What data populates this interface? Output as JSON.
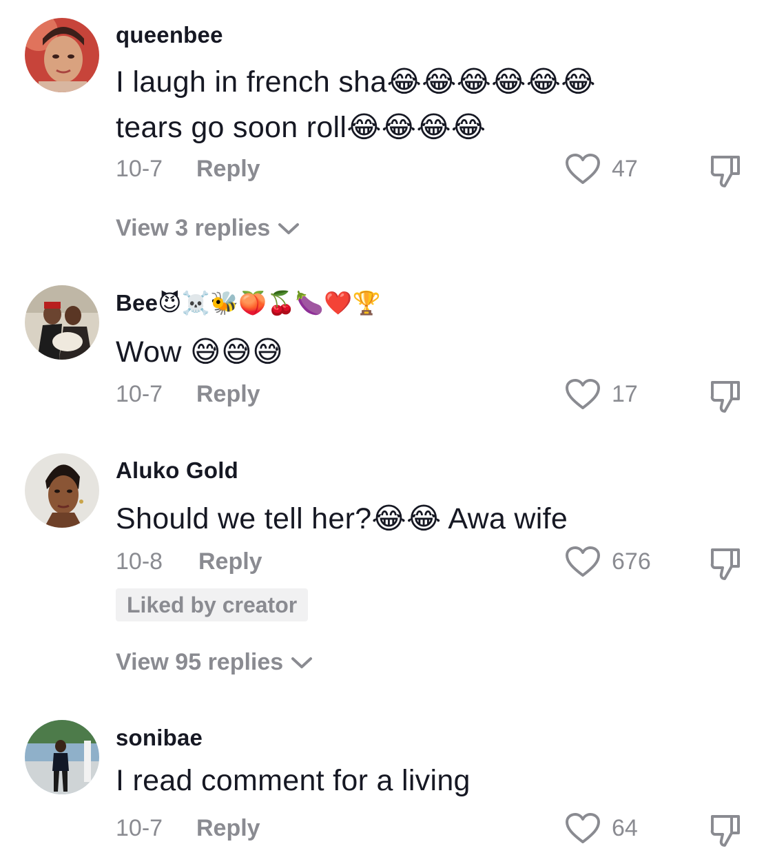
{
  "colors": {
    "text_primary": "#161823",
    "text_secondary": "#8a8b91",
    "badge_bg": "#f1f1f2"
  },
  "comments": [
    {
      "username": "queenbee",
      "text_line1": "I laugh in french sha😂😂😂😂😂😂",
      "text_line2": "tears go soon roll😂😂😂😂",
      "date": "10-7",
      "reply_label": "Reply",
      "likes": "47",
      "view_replies": "View 3 replies"
    },
    {
      "username": "Bee😈☠️🐝🍑🍒🍆❤️🏆",
      "text_line1": "Wow 😅😅😅",
      "date": "10-7",
      "reply_label": "Reply",
      "likes": "17"
    },
    {
      "username": "Aluko Gold",
      "text_line1": "Should we tell her?😂😂 Awa wife",
      "date": "10-8",
      "reply_label": "Reply",
      "likes": "676",
      "badge": "Liked by creator",
      "view_replies": "View 95 replies"
    },
    {
      "username": "sonibae",
      "text_line1": "I read comment for a living",
      "date": "10-7",
      "reply_label": "Reply",
      "likes": "64"
    }
  ],
  "icons": {
    "like": "heart-outline-icon",
    "dislike": "thumbs-down-icon",
    "expand": "chevron-down-icon"
  }
}
